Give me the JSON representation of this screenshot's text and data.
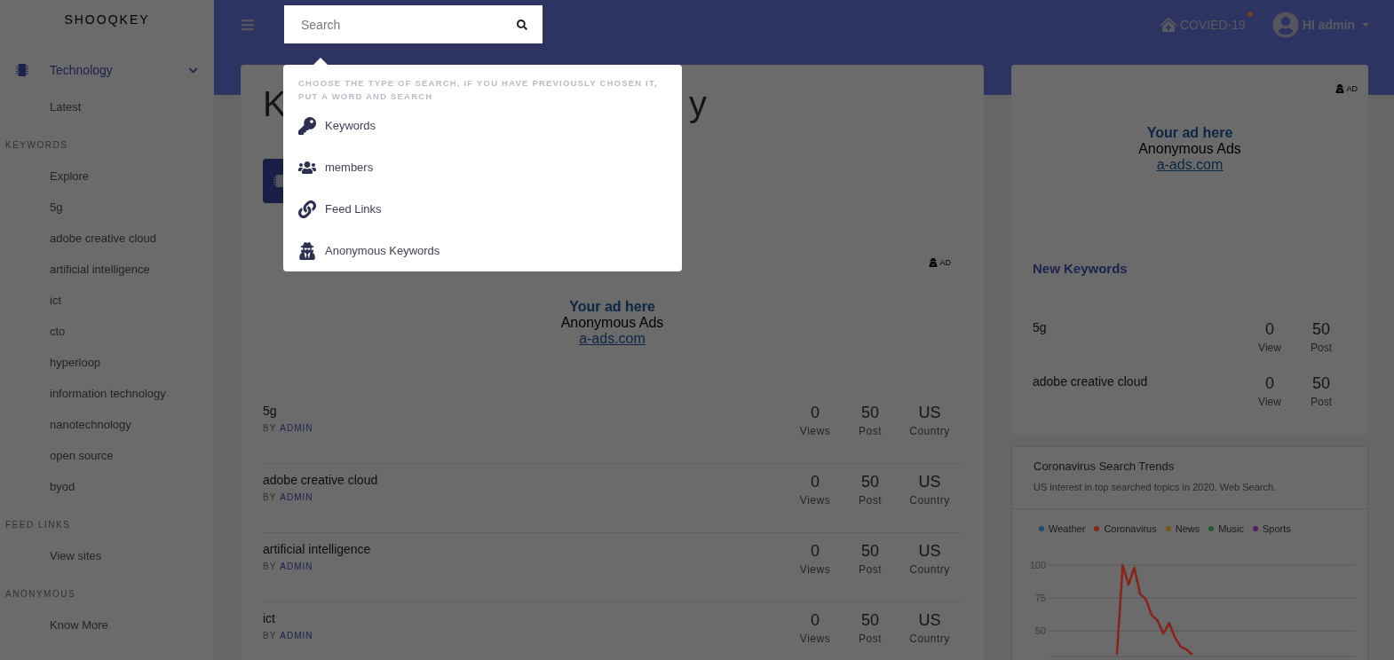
{
  "brand": "SHOOQKEY",
  "sidebar": {
    "category": {
      "label": "Technology",
      "selected": true,
      "expanded": true
    },
    "sections": [
      {
        "items": [
          "Latest"
        ]
      },
      {
        "title": "KEYWORDS",
        "items": [
          "Explore",
          "5g",
          "adobe creative cloud",
          "artificial intelligence",
          "ict",
          "cto",
          "hyperloop",
          "information technology",
          "nanotechnology",
          "open source",
          "byod"
        ]
      },
      {
        "title": "FEED LINKS",
        "items": [
          "View sites"
        ]
      },
      {
        "title": "ANONYMOUS",
        "items": [
          "Know More"
        ]
      }
    ]
  },
  "header": {
    "search": {
      "placeholder": "Search"
    },
    "covid": {
      "label": "COVIED-19",
      "notification": true
    },
    "user": {
      "greeting": "HI admin"
    }
  },
  "search_menu": {
    "open": true,
    "hint": "CHOOSE THE TYPE OF SEARCH, IF YOU HAVE PREVIOUSLY CHOSEN IT, PUT A WORD AND SEARCH",
    "options": [
      {
        "kind": "key",
        "label": "Keywords"
      },
      {
        "kind": "users",
        "label": "members"
      },
      {
        "kind": "link",
        "label": "Feed Links"
      },
      {
        "kind": "spy",
        "label": "Anonymous Keywords"
      }
    ]
  },
  "main": {
    "heading_start": "K",
    "heading_end": "y",
    "ad": {
      "badge": "AD",
      "title": "Your ad here",
      "name": "Anonymous Ads",
      "link": "a-ads.com"
    },
    "keywords": [
      {
        "name": "5g",
        "by": "BY",
        "author": "ADMIN",
        "views": "0",
        "views_label": "Views",
        "posts": "50",
        "posts_label": "Post",
        "country": "US",
        "country_label": "Country"
      },
      {
        "name": "adobe creative cloud",
        "by": "BY",
        "author": "ADMIN",
        "views": "0",
        "views_label": "Views",
        "posts": "50",
        "posts_label": "Post",
        "country": "US",
        "country_label": "Country"
      },
      {
        "name": "artificial intelligence",
        "by": "BY",
        "author": "ADMIN",
        "views": "0",
        "views_label": "Views",
        "posts": "50",
        "posts_label": "Post",
        "country": "US",
        "country_label": "Country"
      },
      {
        "name": "ict",
        "by": "BY",
        "author": "ADMIN",
        "views": "0",
        "views_label": "Views",
        "posts": "50",
        "posts_label": "Post",
        "country": "US",
        "country_label": "Country"
      }
    ]
  },
  "right": {
    "ad": {
      "badge": "AD",
      "title": "Your ad here",
      "name": "Anonymous Ads",
      "link": "a-ads.com"
    },
    "new_keywords": {
      "title": "New Keywords",
      "rows": [
        {
          "name": "5g",
          "views": "0",
          "views_label": "View",
          "posts": "50",
          "posts_label": "Post"
        },
        {
          "name": "adobe creative cloud",
          "views": "0",
          "views_label": "View",
          "posts": "50",
          "posts_label": "Post"
        }
      ]
    },
    "trends": {
      "title": "Coronavirus Search Trends",
      "subtitle": "US interest in top searched topics in 2020. Web Search.",
      "chart_data": {
        "type": "line",
        "ylim": [
          30,
          100
        ],
        "yticks": [
          50,
          75,
          100
        ],
        "series": [
          {
            "name": "Weather",
            "color": "#1f4d70",
            "values": [
              null,
              null,
              null,
              null,
              null,
              null,
              null,
              null,
              null,
              null,
              null,
              null,
              null,
              null,
              null,
              null,
              null,
              null,
              null,
              null,
              null,
              null,
              null,
              null,
              null,
              null,
              null,
              null,
              null,
              null,
              null,
              null,
              null,
              null,
              null,
              null,
              null,
              null,
              null,
              null,
              null,
              null,
              null,
              null,
              null,
              null,
              null,
              null,
              null,
              null,
              null,
              null,
              null
            ]
          },
          {
            "name": "Coronavirus",
            "color": "#8a2219",
            "values": [
              null,
              null,
              null,
              null,
              null,
              null,
              null,
              null,
              null,
              null,
              null,
              32,
              100,
              85,
              98,
              78,
              74,
              62,
              58,
              48,
              56,
              45,
              38,
              36,
              32,
              null,
              null,
              null,
              null,
              null,
              null,
              null,
              null,
              null,
              null,
              null,
              null,
              null,
              null,
              null,
              null,
              null,
              null,
              null,
              null,
              null,
              null,
              null,
              null,
              null,
              null,
              null,
              null
            ]
          },
          {
            "name": "News",
            "color": "#76591a",
            "values": [
              null,
              null,
              null,
              null,
              null,
              null,
              null,
              null,
              null,
              null,
              null,
              null,
              null,
              null,
              null,
              null,
              null,
              null,
              null,
              null,
              null,
              null,
              null,
              null,
              null,
              null,
              null,
              null,
              null,
              null,
              null,
              null,
              null,
              null,
              null,
              null,
              null,
              null,
              null,
              null,
              null,
              null,
              null,
              null,
              null,
              null,
              null,
              null,
              null,
              null,
              null,
              null,
              null
            ]
          },
          {
            "name": "Music",
            "color": "#245a2b",
            "values": [
              null,
              null,
              null,
              null,
              null,
              null,
              null,
              null,
              null,
              null,
              null,
              null,
              null,
              null,
              null,
              null,
              null,
              null,
              null,
              null,
              null,
              null,
              null,
              null,
              null,
              null,
              null,
              null,
              null,
              null,
              null,
              null,
              null,
              null,
              null,
              null,
              null,
              null,
              null,
              null,
              null,
              null,
              null,
              null,
              null,
              null,
              null,
              null,
              null,
              null,
              null,
              null,
              null
            ]
          },
          {
            "name": "Sports",
            "color": "#4f2262",
            "values": [
              null,
              null,
              null,
              null,
              null,
              null,
              null,
              null,
              null,
              null,
              null,
              null,
              null,
              null,
              null,
              null,
              null,
              null,
              null,
              null,
              null,
              null,
              null,
              null,
              null,
              null,
              null,
              null,
              null,
              null,
              null,
              null,
              null,
              null,
              null,
              null,
              null,
              null,
              null,
              null,
              null,
              null,
              null,
              null,
              null,
              null,
              null,
              null,
              null,
              null,
              null,
              null,
              null
            ]
          }
        ]
      }
    }
  }
}
